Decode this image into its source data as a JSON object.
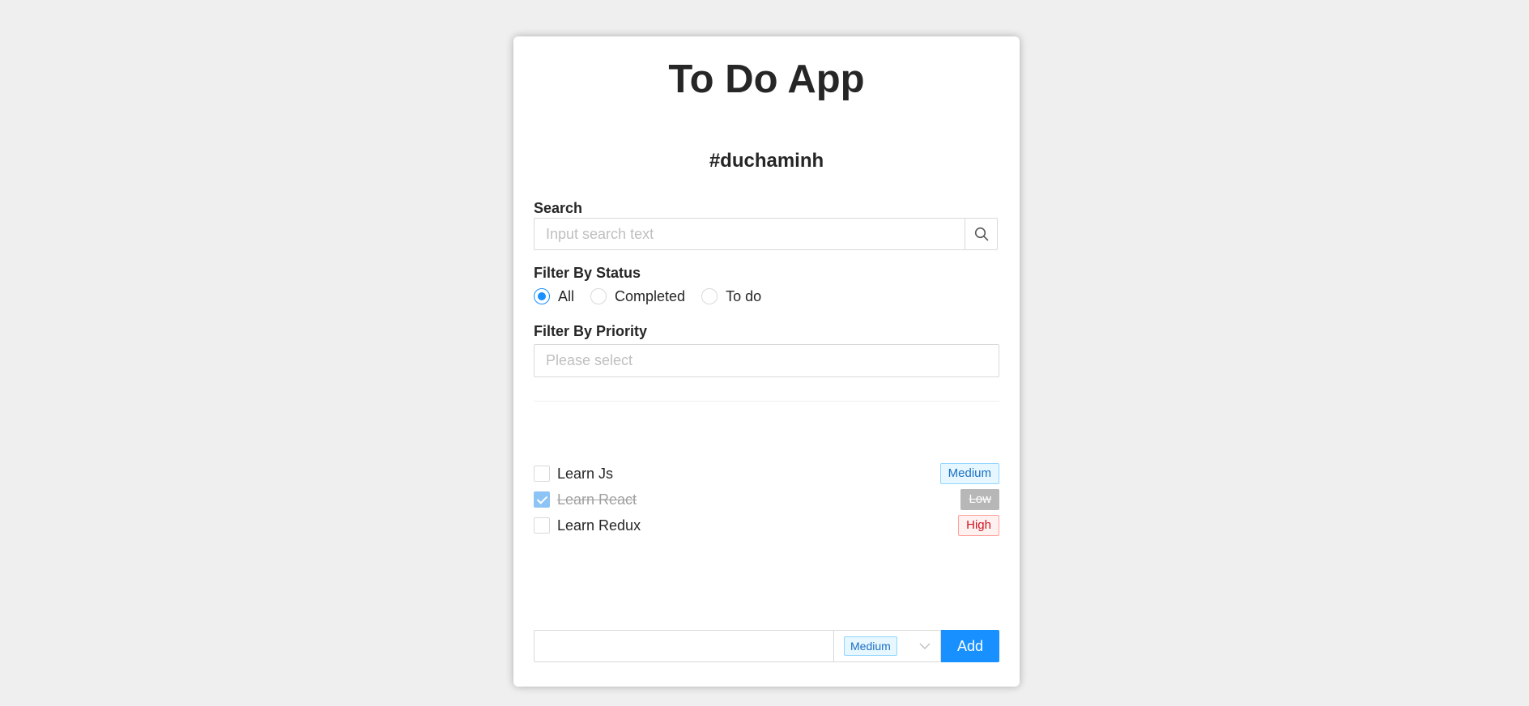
{
  "app": {
    "title": "To Do App",
    "subtitle": "#duchaminh"
  },
  "search": {
    "label": "Search",
    "placeholder": "Input search text",
    "icon": "search-icon"
  },
  "status_filter": {
    "label": "Filter By Status",
    "options": [
      {
        "label": "All",
        "checked": true
      },
      {
        "label": "Completed",
        "checked": false
      },
      {
        "label": "To do",
        "checked": false
      }
    ]
  },
  "priority_filter": {
    "label": "Filter By Priority",
    "placeholder": "Please select"
  },
  "todos": [
    {
      "name": "Learn Js",
      "completed": false,
      "priority": "Medium"
    },
    {
      "name": "Learn React",
      "completed": true,
      "priority": "Low"
    },
    {
      "name": "Learn Redux",
      "completed": false,
      "priority": "High"
    }
  ],
  "add_form": {
    "input_value": "",
    "priority": "Medium",
    "button_label": "Add",
    "dropdown_icon": "chevron-down-icon"
  },
  "colors": {
    "accent": "#1890ff",
    "background": "#efefef",
    "card": "#ffffff"
  }
}
